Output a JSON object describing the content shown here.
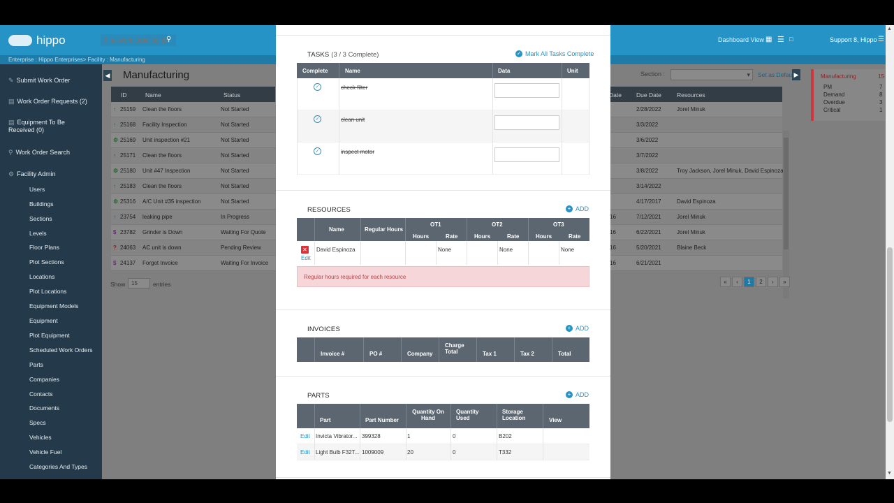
{
  "topbar": {
    "logo": "hippo",
    "search_placeholder": "Find Work Order By ID",
    "dashboard_view": "Dashboard View",
    "user": "Support 8, Hippo"
  },
  "breadcrumb": "Enterprise : Hippo Enterprises> Facility : Manufacturing",
  "sidebar": {
    "main": [
      {
        "label": "Submit Work Order",
        "icon": "pencil-icon"
      },
      {
        "label": "Work Order Requests (2)",
        "icon": "document-icon"
      },
      {
        "label": "Equipment To Be",
        "label2": "Received (0)",
        "icon": "box-icon"
      },
      {
        "label": "Work Order Search",
        "icon": "search-icon"
      },
      {
        "label": "Facility Admin",
        "icon": "gear-icon"
      }
    ],
    "sub": [
      "Users",
      "Buildings",
      "Sections",
      "Levels",
      "Floor Plans",
      "Plot Sections",
      "Locations",
      "Plot Locations",
      "Equipment Models",
      "Equipment",
      "Plot Equipment",
      "Scheduled Work Orders",
      "Parts",
      "Companies",
      "Contacts",
      "Documents",
      "Specs",
      "Vehicles",
      "Vehicle Fuel",
      "Categories And Types"
    ]
  },
  "main": {
    "title": "Manufacturing",
    "section_label": "Section :",
    "set_default": "Set as Default",
    "columns": [
      "ID",
      "Name",
      "Status",
      "Date",
      "Due Date",
      "Resources"
    ],
    "rows": [
      {
        "id": "25159",
        "name": "Clean the floors",
        "status": "Not Started",
        "d": "",
        "due": "2/28/2022",
        "res": "Jorel Minuk",
        "icon": "up-arrow-icon",
        "icolor": "#1f6e2a"
      },
      {
        "id": "25168",
        "name": "Facility Inspection",
        "status": "Not Started",
        "d": "",
        "due": "3/3/2022",
        "res": "",
        "icon": "up-arrow-icon",
        "icolor": "#1f6e2a"
      },
      {
        "id": "25169",
        "name": "Unit inspection #21",
        "status": "Not Started",
        "d": "",
        "due": "3/6/2022",
        "res": "",
        "icon": "gear-icon",
        "icolor": "#1f6e2a"
      },
      {
        "id": "25171",
        "name": "Clean the floors",
        "status": "Not Started",
        "d": "",
        "due": "3/7/2022",
        "res": "",
        "icon": "up-arrow-icon",
        "icolor": "#1f6e2a"
      },
      {
        "id": "25180",
        "name": "Unit #47 Inspection",
        "status": "Not Started",
        "d": "",
        "due": "3/8/2022",
        "res": "Troy Jackson, Jorel Minuk, David Espinoza",
        "icon": "gear-icon",
        "icolor": "#1f6e2a"
      },
      {
        "id": "25183",
        "name": "Clean the floors",
        "status": "Not Started",
        "d": "",
        "due": "3/14/2022",
        "res": "",
        "icon": "up-arrow-icon",
        "icolor": "#1f6e2a"
      },
      {
        "id": "25316",
        "name": "A/C Unit #35 inspection",
        "status": "Not Started",
        "d": "",
        "due": "4/17/2017",
        "res": "David Espinoza",
        "icon": "gear-icon",
        "icolor": "#1f6e2a"
      },
      {
        "id": "23754",
        "name": "leaking pipe",
        "status": "In Progress",
        "d": "16",
        "due": "7/12/2021",
        "res": "Jorel Minuk",
        "icon": "up-arrow-icon",
        "icolor": "#2a5f8a"
      },
      {
        "id": "23782",
        "name": "Grinder is Down",
        "status": "Waiting For Quote",
        "d": "16",
        "due": "6/22/2021",
        "res": "Jorel Minuk",
        "icon": "dollar-icon",
        "icolor": "#6a2a7a"
      },
      {
        "id": "24063",
        "name": "AC unit is down",
        "status": "Pending Review",
        "d": "16",
        "due": "5/20/2021",
        "res": "Blaine Beck",
        "icon": "question-icon",
        "icolor": "#8a2020"
      },
      {
        "id": "24137",
        "name": "Forgot Invoice",
        "status": "Waiting For Invoice",
        "d": "16",
        "due": "6/21/2021",
        "res": "",
        "icon": "dollar-icon",
        "icolor": "#6a2a7a"
      }
    ],
    "show": "Show",
    "page_size": "15",
    "entries": "entries",
    "pages": [
      "«",
      "‹",
      "1",
      "2",
      "›",
      "»"
    ]
  },
  "summary": {
    "title": "Manufacturing",
    "count": "15",
    "items": [
      {
        "label": "PM",
        "value": "7"
      },
      {
        "label": "Demand",
        "value": "8"
      },
      {
        "label": "Overdue",
        "value": "3"
      },
      {
        "label": "Critical",
        "value": "1"
      }
    ]
  },
  "modal": {
    "tasks": {
      "title": "TASKS",
      "subtitle": "(3 / 3 Complete)",
      "mark_all": "Mark All Tasks Complete",
      "headers": [
        "Complete",
        "Name",
        "Data",
        "Unit"
      ],
      "items": [
        "check filter",
        "clean unit",
        "inspect motor"
      ]
    },
    "resources": {
      "title": "RESOURCES",
      "add": "ADD",
      "headers": {
        "name": "Name",
        "regular": "Regular Hours",
        "ot1": "OT1",
        "ot2": "OT2",
        "ot3": "OT3",
        "hours": "Hours",
        "rate": "Rate"
      },
      "row": {
        "edit": "Edit",
        "name": "David Espinoza",
        "ot1_rate": "None",
        "ot2_rate": "None",
        "ot3_rate": "None"
      },
      "alert": "Regular hours required for each resource"
    },
    "invoices": {
      "title": "INVOICES",
      "add": "ADD",
      "headers": [
        "Invoice #",
        "PO #",
        "Company",
        "Charge Total",
        "Tax 1",
        "Tax 2",
        "Total"
      ]
    },
    "parts": {
      "title": "PARTS",
      "add": "ADD",
      "headers": [
        "Part",
        "Part Number",
        "Quantity On Hand",
        "Quantity Used",
        "Storage Location",
        "View"
      ],
      "rows": [
        {
          "edit": "Edit",
          "part": "Invicta Vibrator...",
          "number": "399328",
          "onhand": "1",
          "used": "0",
          "loc": "B202"
        },
        {
          "edit": "Edit",
          "part": "Light Bulb F32T...",
          "number": "1009009",
          "onhand": "20",
          "used": "0",
          "loc": "T332"
        }
      ]
    }
  }
}
